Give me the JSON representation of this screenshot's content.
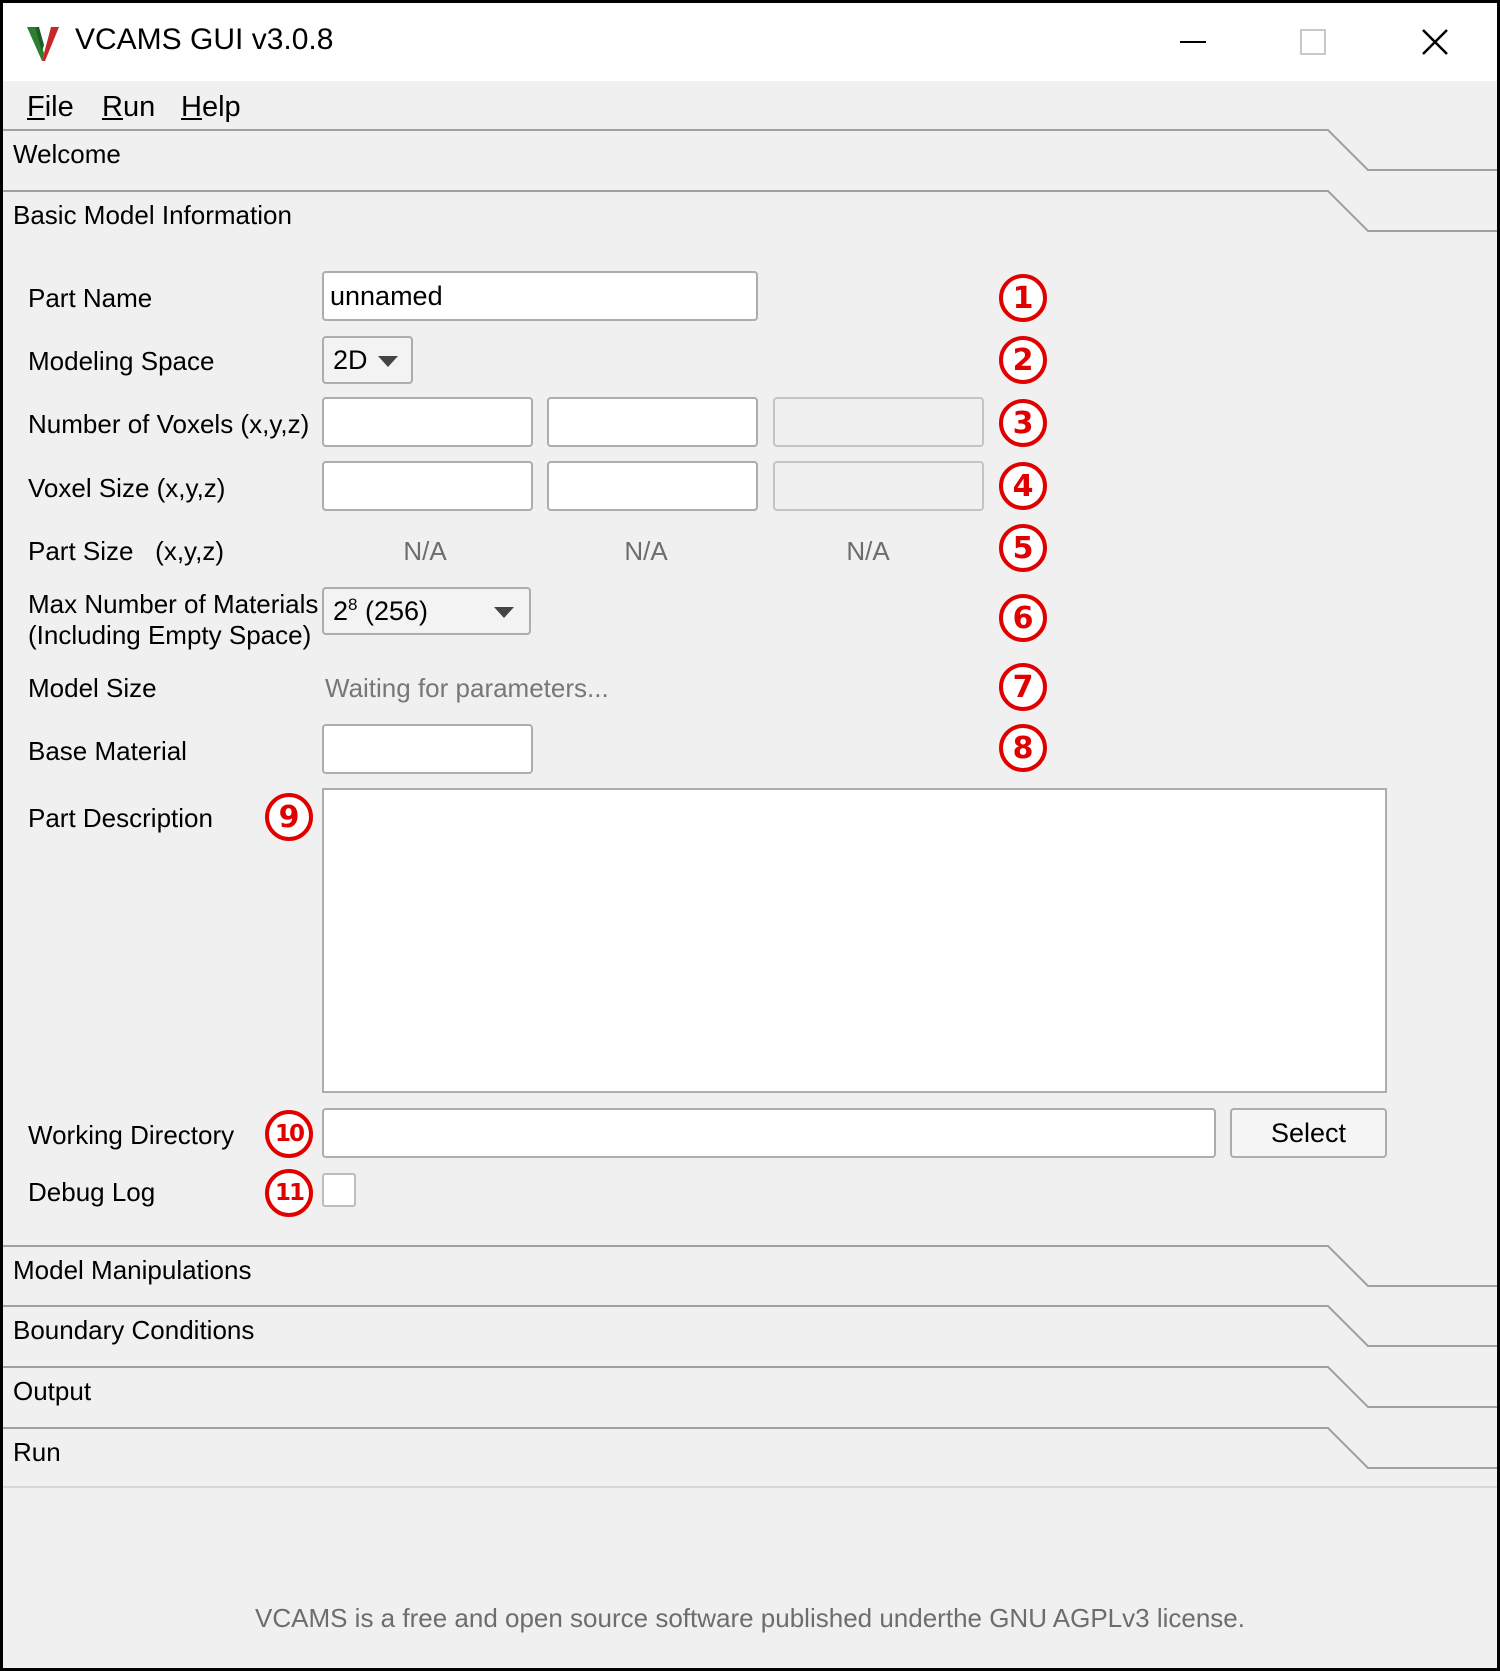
{
  "window": {
    "title": "VCAMS GUI v3.0.8",
    "controls": [
      "minimize",
      "maximize",
      "close"
    ]
  },
  "menu": {
    "items": [
      {
        "accel": "F",
        "rest": "ile"
      },
      {
        "accel": "R",
        "rest": "un"
      },
      {
        "accel": "H",
        "rest": "elp"
      }
    ]
  },
  "sections": {
    "welcome": "Welcome",
    "basic": "Basic Model Information",
    "manipulations": "Model Manipulations",
    "boundary": "Boundary Conditions",
    "output": "Output",
    "run": "Run"
  },
  "form": {
    "part_name": {
      "label": "Part Name",
      "value": "unnamed"
    },
    "modeling_space": {
      "label": "Modeling Space",
      "value": "2D"
    },
    "num_voxels": {
      "label": "Number of Voxels (x,y,z)",
      "values": [
        "",
        "",
        ""
      ],
      "z_disabled": true
    },
    "voxel_size": {
      "label": "Voxel Size (x,y,z)",
      "values": [
        "",
        "",
        ""
      ],
      "z_disabled": true
    },
    "part_size": {
      "label": "Part Size   (x,y,z)",
      "values": [
        "N/A",
        "N/A",
        "N/A"
      ]
    },
    "max_materials": {
      "label_line1": "Max Number of Materials",
      "label_line2": "(Including Empty Space)",
      "value_base": "2",
      "value_exp": "8",
      "value_rest": " (256)"
    },
    "model_size": {
      "label": "Model Size",
      "value": "Waiting for parameters..."
    },
    "base_material": {
      "label": "Base Material",
      "value": ""
    },
    "part_description": {
      "label": "Part Description",
      "value": ""
    },
    "working_directory": {
      "label": "Working Directory",
      "value": "",
      "button": "Select"
    },
    "debug_log": {
      "label": "Debug Log",
      "checked": false
    }
  },
  "callouts": [
    "1",
    "2",
    "3",
    "4",
    "5",
    "6",
    "7",
    "8",
    "9",
    "10",
    "11"
  ],
  "footer": "VCAMS is a free and open source software published underthe GNU AGPLv3 license.",
  "colors": {
    "callout": "#e00000",
    "logo_green": "#2e7d32",
    "logo_red": "#c62828"
  }
}
